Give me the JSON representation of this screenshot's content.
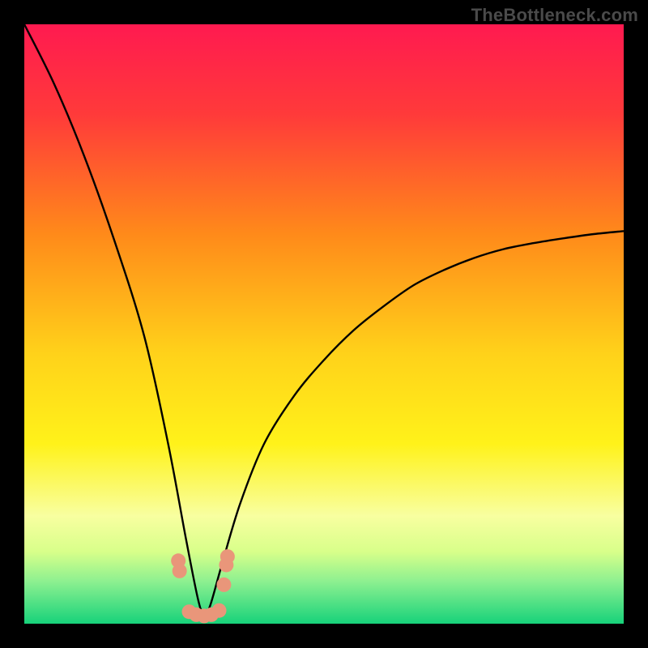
{
  "watermark": "TheBottleneck.com",
  "colors": {
    "frame": "#000000",
    "curve": "#000000",
    "marker": "#e9967a",
    "gradient_stops": [
      {
        "offset": 0.0,
        "color": "#ff1a50"
      },
      {
        "offset": 0.15,
        "color": "#ff3a3a"
      },
      {
        "offset": 0.35,
        "color": "#ff8a1a"
      },
      {
        "offset": 0.55,
        "color": "#ffd21a"
      },
      {
        "offset": 0.7,
        "color": "#fff21a"
      },
      {
        "offset": 0.82,
        "color": "#f8ffa0"
      },
      {
        "offset": 0.88,
        "color": "#d8ff8a"
      },
      {
        "offset": 0.93,
        "color": "#8cf090"
      },
      {
        "offset": 1.0,
        "color": "#17d27a"
      }
    ]
  },
  "chart_data": {
    "type": "line",
    "title": "",
    "xlabel": "",
    "ylabel": "",
    "xlim": [
      0,
      100
    ],
    "ylim": [
      0,
      100
    ],
    "note": "Bottleneck-style V-curve. y≈0 around the minimum at x≈30; rises steeply to y≈100 as x→0 and more gradually toward y≈65 as x→100.",
    "series": [
      {
        "name": "bottleneck_curve",
        "x": [
          0,
          5,
          10,
          15,
          20,
          24,
          27,
          29,
          30,
          31,
          33,
          36,
          40,
          45,
          50,
          55,
          60,
          65,
          70,
          75,
          80,
          85,
          90,
          95,
          100
        ],
        "y": [
          100,
          90,
          78,
          64,
          48,
          30,
          14,
          4,
          1.5,
          3,
          10,
          20,
          30,
          38,
          44,
          49,
          53,
          56.5,
          59,
          61,
          62.5,
          63.5,
          64.3,
          65,
          65.5
        ]
      }
    ],
    "markers": [
      {
        "x": 25.7,
        "y": 10.5
      },
      {
        "x": 25.9,
        "y": 8.8
      },
      {
        "x": 27.5,
        "y": 2.0
      },
      {
        "x": 28.7,
        "y": 1.5
      },
      {
        "x": 30.0,
        "y": 1.3
      },
      {
        "x": 31.2,
        "y": 1.5
      },
      {
        "x": 32.5,
        "y": 2.2
      },
      {
        "x": 33.3,
        "y": 6.5
      },
      {
        "x": 33.7,
        "y": 9.8
      },
      {
        "x": 33.9,
        "y": 11.2
      }
    ]
  }
}
